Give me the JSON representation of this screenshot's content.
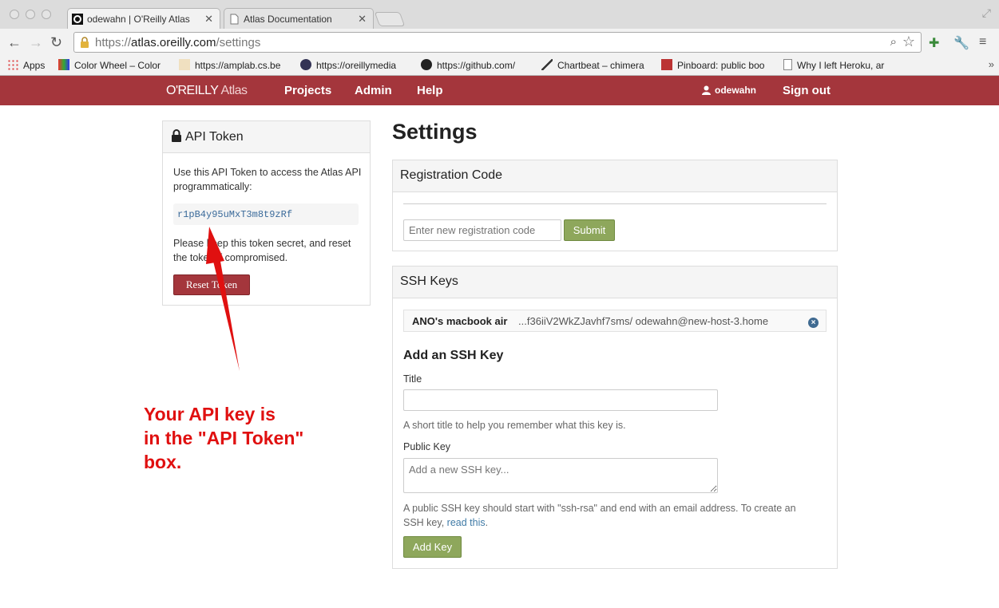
{
  "browser": {
    "tabs": [
      {
        "label": "odewahn | O'Reilly Atlas",
        "active": true
      },
      {
        "label": "Atlas Documentation",
        "active": false
      }
    ],
    "url": {
      "scheme": "https://",
      "host": "atlas.oreilly.com",
      "path": "/settings"
    },
    "bookmarks": [
      {
        "label": "Apps",
        "icon": "apps-grid-icon"
      },
      {
        "label": "Color Wheel – Color",
        "icon": "color-wheel-icon"
      },
      {
        "label": "https://amplab.cs.be",
        "icon": "amplab-icon"
      },
      {
        "label": "https://oreillymedia",
        "icon": "oreilly-icon"
      },
      {
        "label": "https://github.com/",
        "icon": "github-icon"
      },
      {
        "label": "Chartbeat – chimera",
        "icon": "chartbeat-icon"
      },
      {
        "label": "Pinboard: public boo",
        "icon": "pinboard-icon"
      },
      {
        "label": "Why I left Heroku, ar",
        "icon": "page-icon"
      }
    ],
    "bookmarks_more": "»"
  },
  "app": {
    "logo_oreilly": "O'REILLY",
    "logo_atlas": "Atlas",
    "nav": [
      "Projects",
      "Admin",
      "Help"
    ],
    "username": "odewahn",
    "sign_out": "Sign out",
    "brand_color": "#a4363c"
  },
  "token_panel": {
    "title": "API Token",
    "description": "Use this API Token to access the Atlas API programmatically:",
    "token": "r1pB4y95uMxT3m8t9zRf",
    "note": "Please keep this token secret, and reset the token if compromised.",
    "reset_label": "Reset Token"
  },
  "settings": {
    "title": "Settings",
    "registration": {
      "title": "Registration Code",
      "placeholder": "Enter new registration code",
      "submit_label": "Submit"
    },
    "ssh": {
      "title": "SSH Keys",
      "keys": [
        {
          "name": "ANO's macbook air",
          "fingerprint": "...f36iiV2WkZJavhf7sms/ odewahn@new-host-3.home"
        }
      ],
      "add_title": "Add an SSH Key",
      "title_label": "Title",
      "title_help": "A short title to help you remember what this key is.",
      "key_label": "Public Key",
      "key_placeholder": "Add a new SSH key...",
      "key_help": "A public SSH key should start with \"ssh-rsa\" and end with an email address. To create an SSH key,",
      "key_help_link": "read this",
      "key_help_end": ".",
      "add_label": "Add Key"
    }
  },
  "annotation": {
    "lines": [
      "Your API key is",
      "in the \"API Token\"",
      "box."
    ],
    "color": "#e01010"
  }
}
